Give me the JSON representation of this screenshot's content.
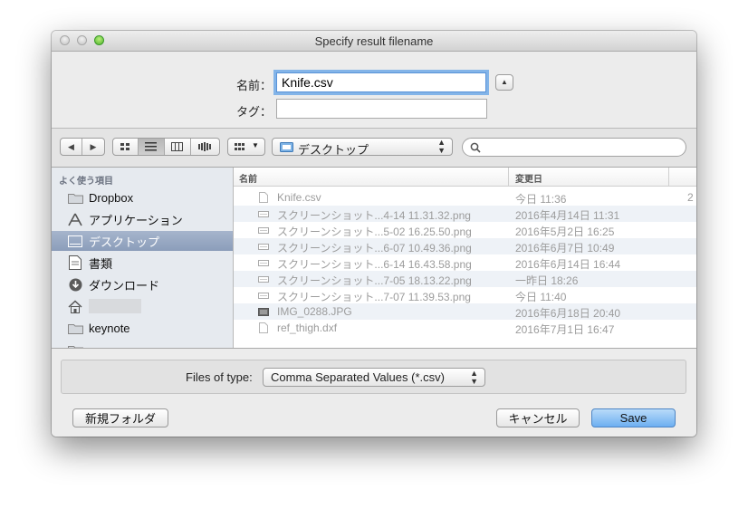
{
  "window": {
    "title": "Specify result filename"
  },
  "form": {
    "name_label": "名前：",
    "name_value": "Knife.csv",
    "tags_label": "タグ：",
    "tags_value": ""
  },
  "toolbar": {
    "view_modes": [
      "icon-view",
      "list-view",
      "column-view",
      "coverflow-view"
    ],
    "selected_view": "list-view",
    "location": "デスクトップ",
    "search_value": ""
  },
  "sidebar": {
    "heading": "よく使う項目",
    "items": [
      {
        "label": "Dropbox",
        "icon": "folder-icon"
      },
      {
        "label": "アプリケーション",
        "icon": "applications-icon"
      },
      {
        "label": "デスクトップ",
        "icon": "desktop-icon",
        "selected": true
      },
      {
        "label": "書類",
        "icon": "documents-icon"
      },
      {
        "label": "ダウンロード",
        "icon": "downloads-icon"
      },
      {
        "label": "",
        "icon": "home-icon"
      },
      {
        "label": "keynote",
        "icon": "folder-icon"
      }
    ]
  },
  "file_list": {
    "columns": {
      "name": "名前",
      "date": "変更日"
    },
    "rows": [
      {
        "name": "Knife.csv",
        "date": "今日 11:36",
        "size": "2",
        "icon": "document-icon"
      },
      {
        "name": "スクリーンショット...4-14 11.31.32.png",
        "date": "2016年4月14日 11:31",
        "icon": "image-icon"
      },
      {
        "name": "スクリーンショット...5-02 16.25.50.png",
        "date": "2016年5月2日 16:25",
        "icon": "image-icon"
      },
      {
        "name": "スクリーンショット...6-07 10.49.36.png",
        "date": "2016年6月7日 10:49",
        "icon": "image-icon"
      },
      {
        "name": "スクリーンショット...6-14 16.43.58.png",
        "date": "2016年6月14日 16:44",
        "icon": "image-icon"
      },
      {
        "name": "スクリーンショット...7-05 18.13.22.png",
        "date": "一昨日 18:26",
        "icon": "image-icon"
      },
      {
        "name": "スクリーンショット...7-07 11.39.53.png",
        "date": "今日 11:40",
        "icon": "image-icon"
      },
      {
        "name": "IMG_0288.JPG",
        "date": "2016年6月18日 20:40",
        "icon": "photo-icon"
      },
      {
        "name": "ref_thigh.dxf",
        "date": "2016年7月1日 16:47",
        "icon": "document-icon"
      }
    ]
  },
  "bottom": {
    "files_of_type_label": "Files of type:",
    "files_of_type_value": "Comma Separated Values (*.csv)",
    "new_folder_label": "新規フォルダ",
    "cancel_label": "キャンセル",
    "save_label": "Save"
  },
  "colors": {
    "accent": "#6daff1",
    "selection": "#8b9dba",
    "focus_ring": "#83b4e8"
  }
}
